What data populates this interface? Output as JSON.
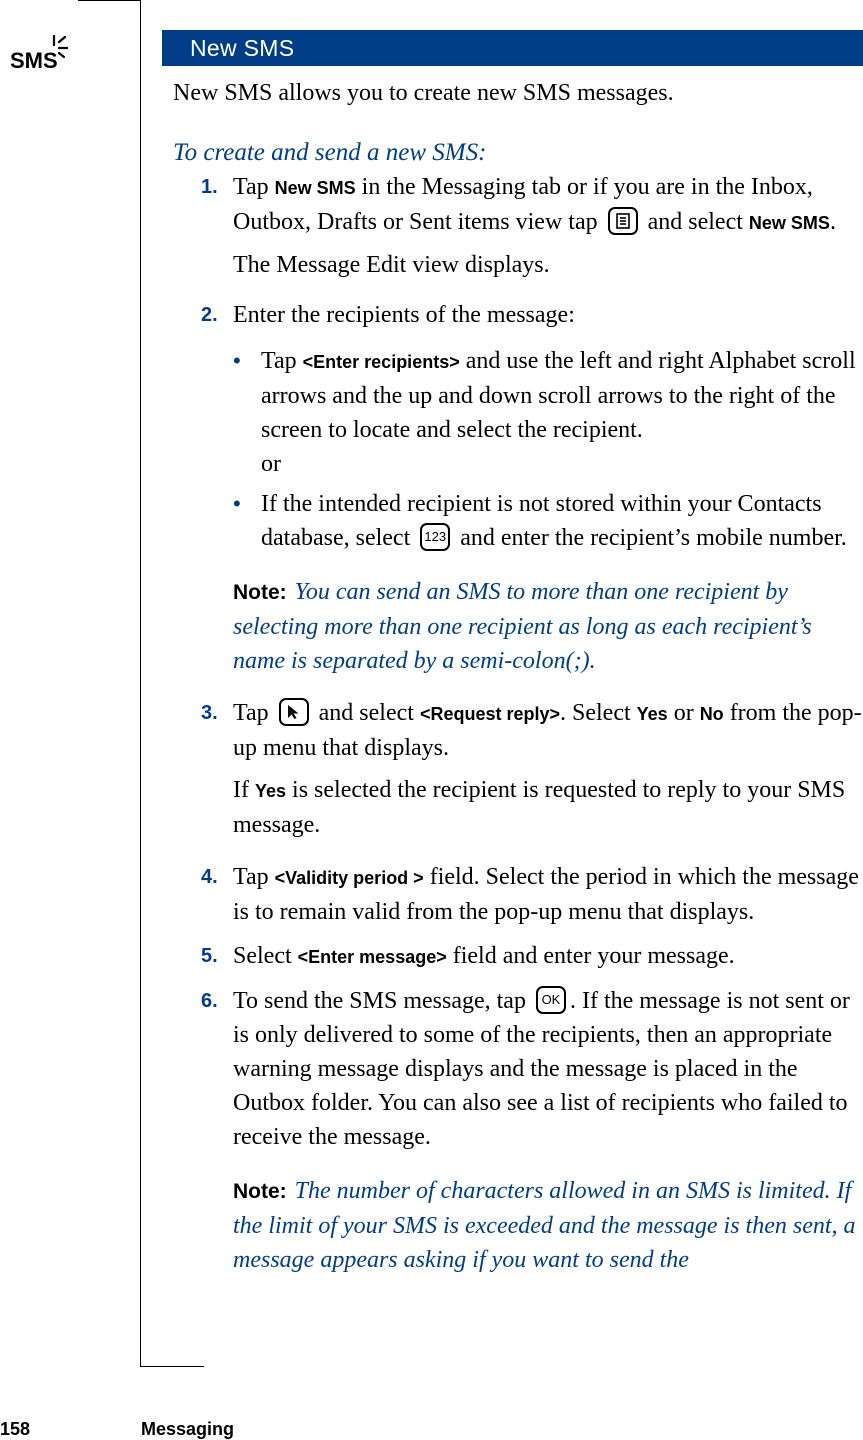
{
  "section": {
    "logo_text": "SMS",
    "header": "New SMS",
    "intro": "New SMS allows you to create new SMS messages.",
    "procedure_title": "To create and send a new SMS:"
  },
  "steps": [
    {
      "num": "1.",
      "parts": {
        "a": "Tap ",
        "b1": "New SMS",
        "c": " in the Messaging tab or if you are in the Inbox, Outbox, Drafts or Sent items view tap ",
        "icon": "menu-icon",
        "d": " and select ",
        "b2": "New SMS",
        "e": "."
      },
      "sub": "The Message Edit view displays."
    },
    {
      "num": "2.",
      "text": "Enter the recipients of the message:",
      "bullets": [
        {
          "a": "Tap ",
          "b": "<Enter recipients>",
          "c": " and use the left and right Alphabet scroll arrows and the up and down scroll arrows to the right of the screen to locate and select the recipient."
        },
        {
          "a": "If the intended recipient is not stored within your Contacts database, select ",
          "icon_label": "123",
          "c": " and enter the recipient’s mobile number."
        }
      ],
      "or": "or",
      "note": {
        "label": "Note:",
        "text": "You can send an SMS to more than one recipient by selecting more than one recipient as long as each recipient’s name is separated by a semi-colon(;)."
      }
    },
    {
      "num": "3.",
      "parts": {
        "a": "Tap ",
        "icon": "pointer-icon",
        "b": " and select ",
        "b1": "<Request reply>",
        "c": ". Select ",
        "b2": "Yes",
        "d": " or ",
        "b3": "No",
        "e": " from the pop-up menu that displays."
      },
      "sub": {
        "a": "If ",
        "b": "Yes",
        "c": " is selected the recipient is requested to reply to your SMS message."
      }
    },
    {
      "num": "4.",
      "parts": {
        "a": "Tap ",
        "b1": "<Validity period >",
        "c": " field. Select the period in which the message is to remain valid from the pop-up menu that displays."
      }
    },
    {
      "num": "5.",
      "parts": {
        "a": "Select ",
        "b1": "<Enter message>",
        "c": " field and enter your message."
      }
    },
    {
      "num": "6.",
      "parts": {
        "a": "To send the SMS message, tap ",
        "icon_label": "OK",
        "c": ". If the message is not sent or is only delivered to some of the recipients, then an appropriate warning message displays and the message is placed in the Outbox folder. You can also see a list of recipients who failed to receive the message."
      },
      "note": {
        "label": "Note:",
        "text": "The number of characters allowed in an SMS is limited. If the limit of your SMS is exceeded and the message is then sent, a message appears asking if you want to send the"
      }
    }
  ],
  "footer": {
    "page_number": "158",
    "chapter": "Messaging"
  },
  "colors": {
    "accent": "#003d86",
    "text": "#000000",
    "header_text": "#ffffff"
  }
}
